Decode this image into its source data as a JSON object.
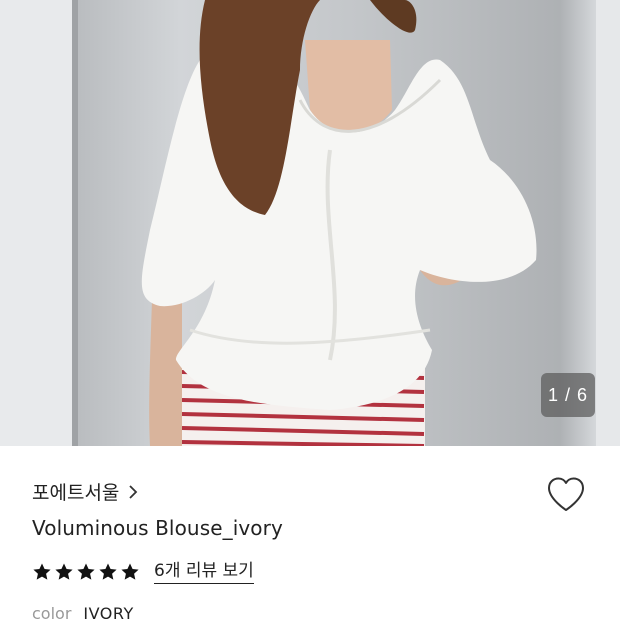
{
  "gallery": {
    "counter": "1 / 6"
  },
  "product": {
    "brand": "포에트서울",
    "title": "Voluminous Blouse_ivory",
    "rating": 5,
    "reviews_link": "6개 리뷰 보기",
    "color_label": "color",
    "color_value": "IVORY"
  },
  "icons": {
    "brand_chevron": "chevron-right-icon",
    "wishlist": "heart-icon",
    "star": "star-icon"
  },
  "colors": {
    "text": "#222222",
    "muted": "#999999",
    "star": "#111111",
    "counter_bg": "#5a5a5a"
  }
}
